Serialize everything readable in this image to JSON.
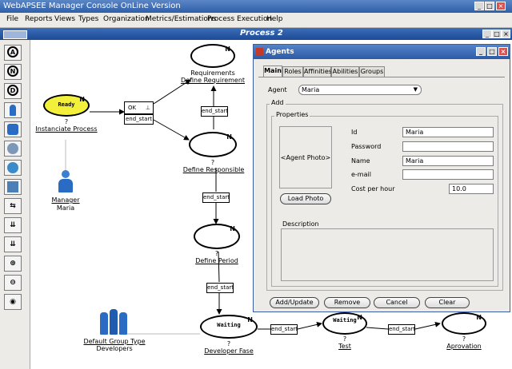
{
  "window": {
    "title": "WebAPSEE Manager Console OnLine Version"
  },
  "menu": {
    "items": [
      "File",
      "Reports",
      "Views",
      "Types",
      "Organization",
      "Metrics/Estimations",
      "Process Execution",
      "Help"
    ]
  },
  "process": {
    "title": "Process 2"
  },
  "toolbar": {
    "tools": [
      "A",
      "N",
      "D"
    ]
  },
  "graph": {
    "nodes": {
      "instanciate": {
        "state": "Ready",
        "q": "?",
        "name": "Instanciate Process"
      },
      "requirements": {
        "q": "Requirements",
        "name": "Define Requirement"
      },
      "responsible": {
        "q": "?",
        "name": "Define Responsible"
      },
      "period": {
        "q": "?",
        "name": "Define Period"
      },
      "developer": {
        "state": "Waiting",
        "q": "?",
        "name": "Developer Fase"
      },
      "test": {
        "state": "Waiting",
        "q": "?",
        "name": "Test"
      },
      "aprovation": {
        "q": "?",
        "name": "Aprovation"
      },
      "letter": "N"
    },
    "connectors": {
      "ok": "OK",
      "end_start": "end_start"
    },
    "manager": {
      "role": "Manager",
      "name": "Maria"
    },
    "group": {
      "type": "Default Group Type",
      "name": "Developers"
    }
  },
  "dialog": {
    "title": "Agents",
    "tabs": [
      "Main",
      "Roles",
      "Affinities",
      "Abilities",
      "Groups"
    ],
    "agent_label": "Agent",
    "agent_value": "Maria",
    "add_label": "Add",
    "properties_label": "Properties",
    "photo_label": "<Agent Photo>",
    "load_photo": "Load Photo",
    "fields": {
      "id": {
        "label": "Id",
        "value": "Maria"
      },
      "password": {
        "label": "Password",
        "value": ""
      },
      "name": {
        "label": "Name",
        "value": "Maria"
      },
      "email": {
        "label": "e-mail",
        "value": ""
      },
      "cost": {
        "label": "Cost per hour",
        "value": "10.0"
      }
    },
    "description_label": "Description",
    "buttons": {
      "add_update": "Add/Update",
      "remove": "Remove",
      "cancel": "Cancel",
      "clear": "Clear"
    }
  },
  "colors": {
    "titlebar": "#2f5fa8",
    "ready_fill": "#f2f03a",
    "dialog_title": "#2c5aa6"
  }
}
